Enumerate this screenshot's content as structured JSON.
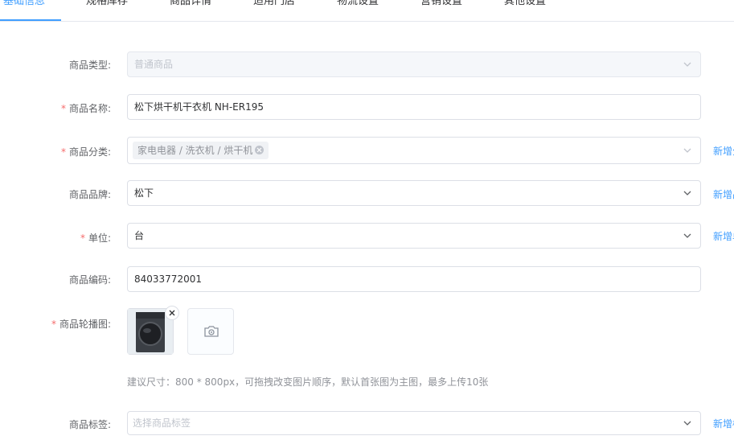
{
  "tabs": [
    {
      "label": "基础信息",
      "active": true
    },
    {
      "label": "规格库存",
      "active": false
    },
    {
      "label": "商品详情",
      "active": false
    },
    {
      "label": "适用门店",
      "active": false
    },
    {
      "label": "物流设置",
      "active": false
    },
    {
      "label": "营销设置",
      "active": false
    },
    {
      "label": "其他设置",
      "active": false
    }
  ],
  "colors": {
    "accent": "#409eff",
    "required": "#f56c6c",
    "border": "#dcdfe6"
  },
  "form": {
    "product_type": {
      "label": "商品类型:",
      "value": "普通商品",
      "disabled": true,
      "icon": "chevron-down-icon"
    },
    "product_name": {
      "label": "商品名称:",
      "required": true,
      "value": "松下烘干机干衣机 NH-ER195"
    },
    "category": {
      "label": "商品分类:",
      "required": true,
      "tag": "家电电器 / 洗衣机 / 烘干机",
      "side_link": "新增分类",
      "icon": "chevron-down-icon"
    },
    "brand": {
      "label": "商品品牌:",
      "value": "松下",
      "side_link": "新增品牌",
      "icon": "chevron-down-icon"
    },
    "unit": {
      "label": "单位:",
      "required": true,
      "value": "台",
      "side_link": "新增单位",
      "icon": "chevron-down-icon"
    },
    "code": {
      "label": "商品编码:",
      "value": "84033772001"
    },
    "carousel": {
      "label": "商品轮播图:",
      "required": true,
      "hint": "建议尺寸：800 * 800px，可拖拽改变图片顺序，默认首张图为主图，最多上传10张",
      "icon": "camera-icon"
    },
    "tags": {
      "label": "商品标签:",
      "placeholder": "选择商品标签",
      "side_link": "新增标签",
      "icon": "chevron-down-icon"
    }
  }
}
